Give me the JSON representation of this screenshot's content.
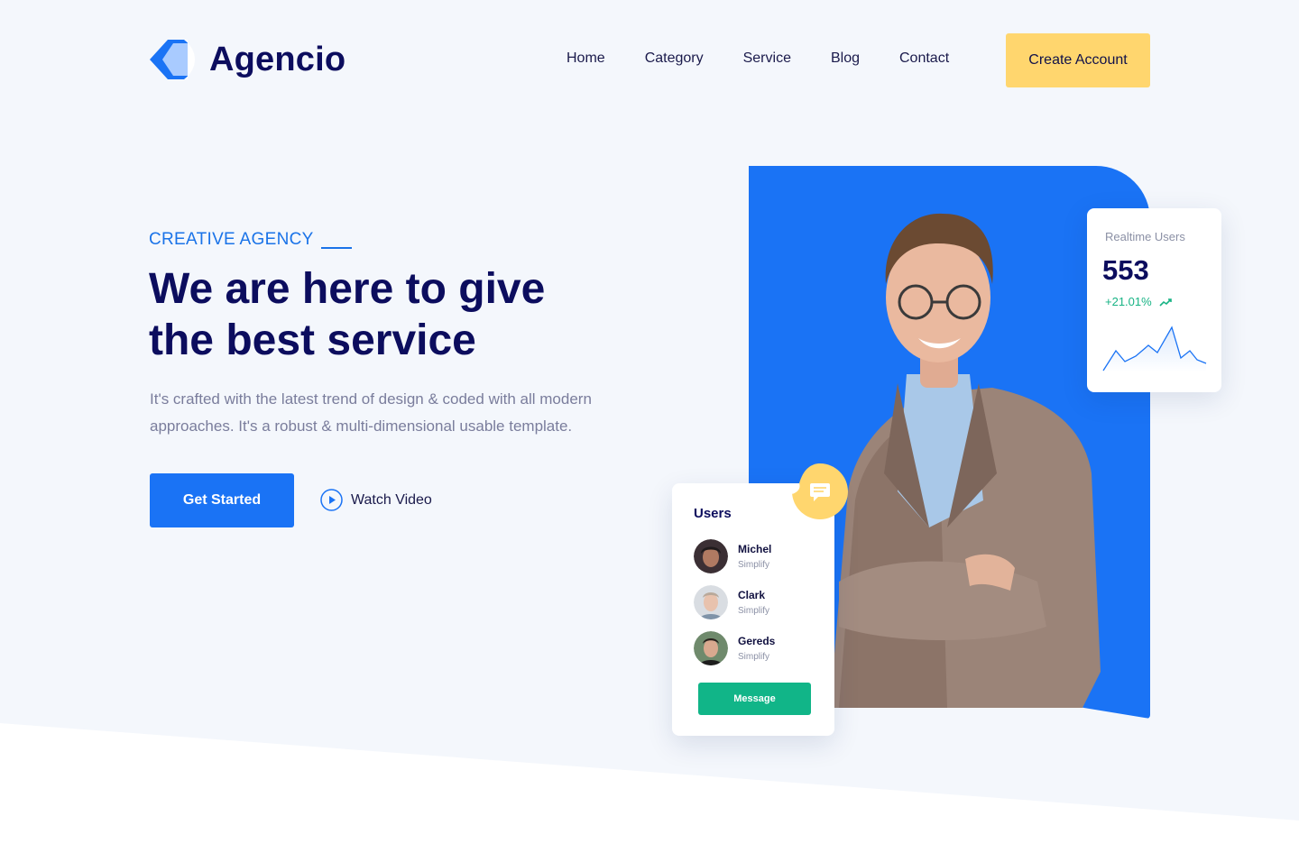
{
  "brand": {
    "name": "Agencio"
  },
  "nav": {
    "items": [
      "Home",
      "Category",
      "Service",
      "Blog",
      "Contact"
    ],
    "cta_label": "Create Account"
  },
  "hero": {
    "eyebrow": "CREATIVE AGENCY",
    "headline_line1": "We are here to give",
    "headline_line2": "the best service",
    "description": "It's crafted with the latest trend of design & coded with all modern approaches. It's a robust & multi-dimensional usable template.",
    "primary_button": "Get Started",
    "video_link": "Watch Video"
  },
  "realtime_card": {
    "title": "Realtime Users",
    "value": "553",
    "change": "+21.01%"
  },
  "users_card": {
    "title": "Users",
    "users": [
      {
        "name": "Michel",
        "subtitle": "Simplify"
      },
      {
        "name": "Clark",
        "subtitle": "Simplify"
      },
      {
        "name": "Gereds",
        "subtitle": "Simplify"
      }
    ],
    "button_label": "Message"
  },
  "colors": {
    "primary": "#1a73f5",
    "accent_yellow": "#ffd66e",
    "success_green": "#11b588",
    "heading_navy": "#0c0d5e"
  }
}
